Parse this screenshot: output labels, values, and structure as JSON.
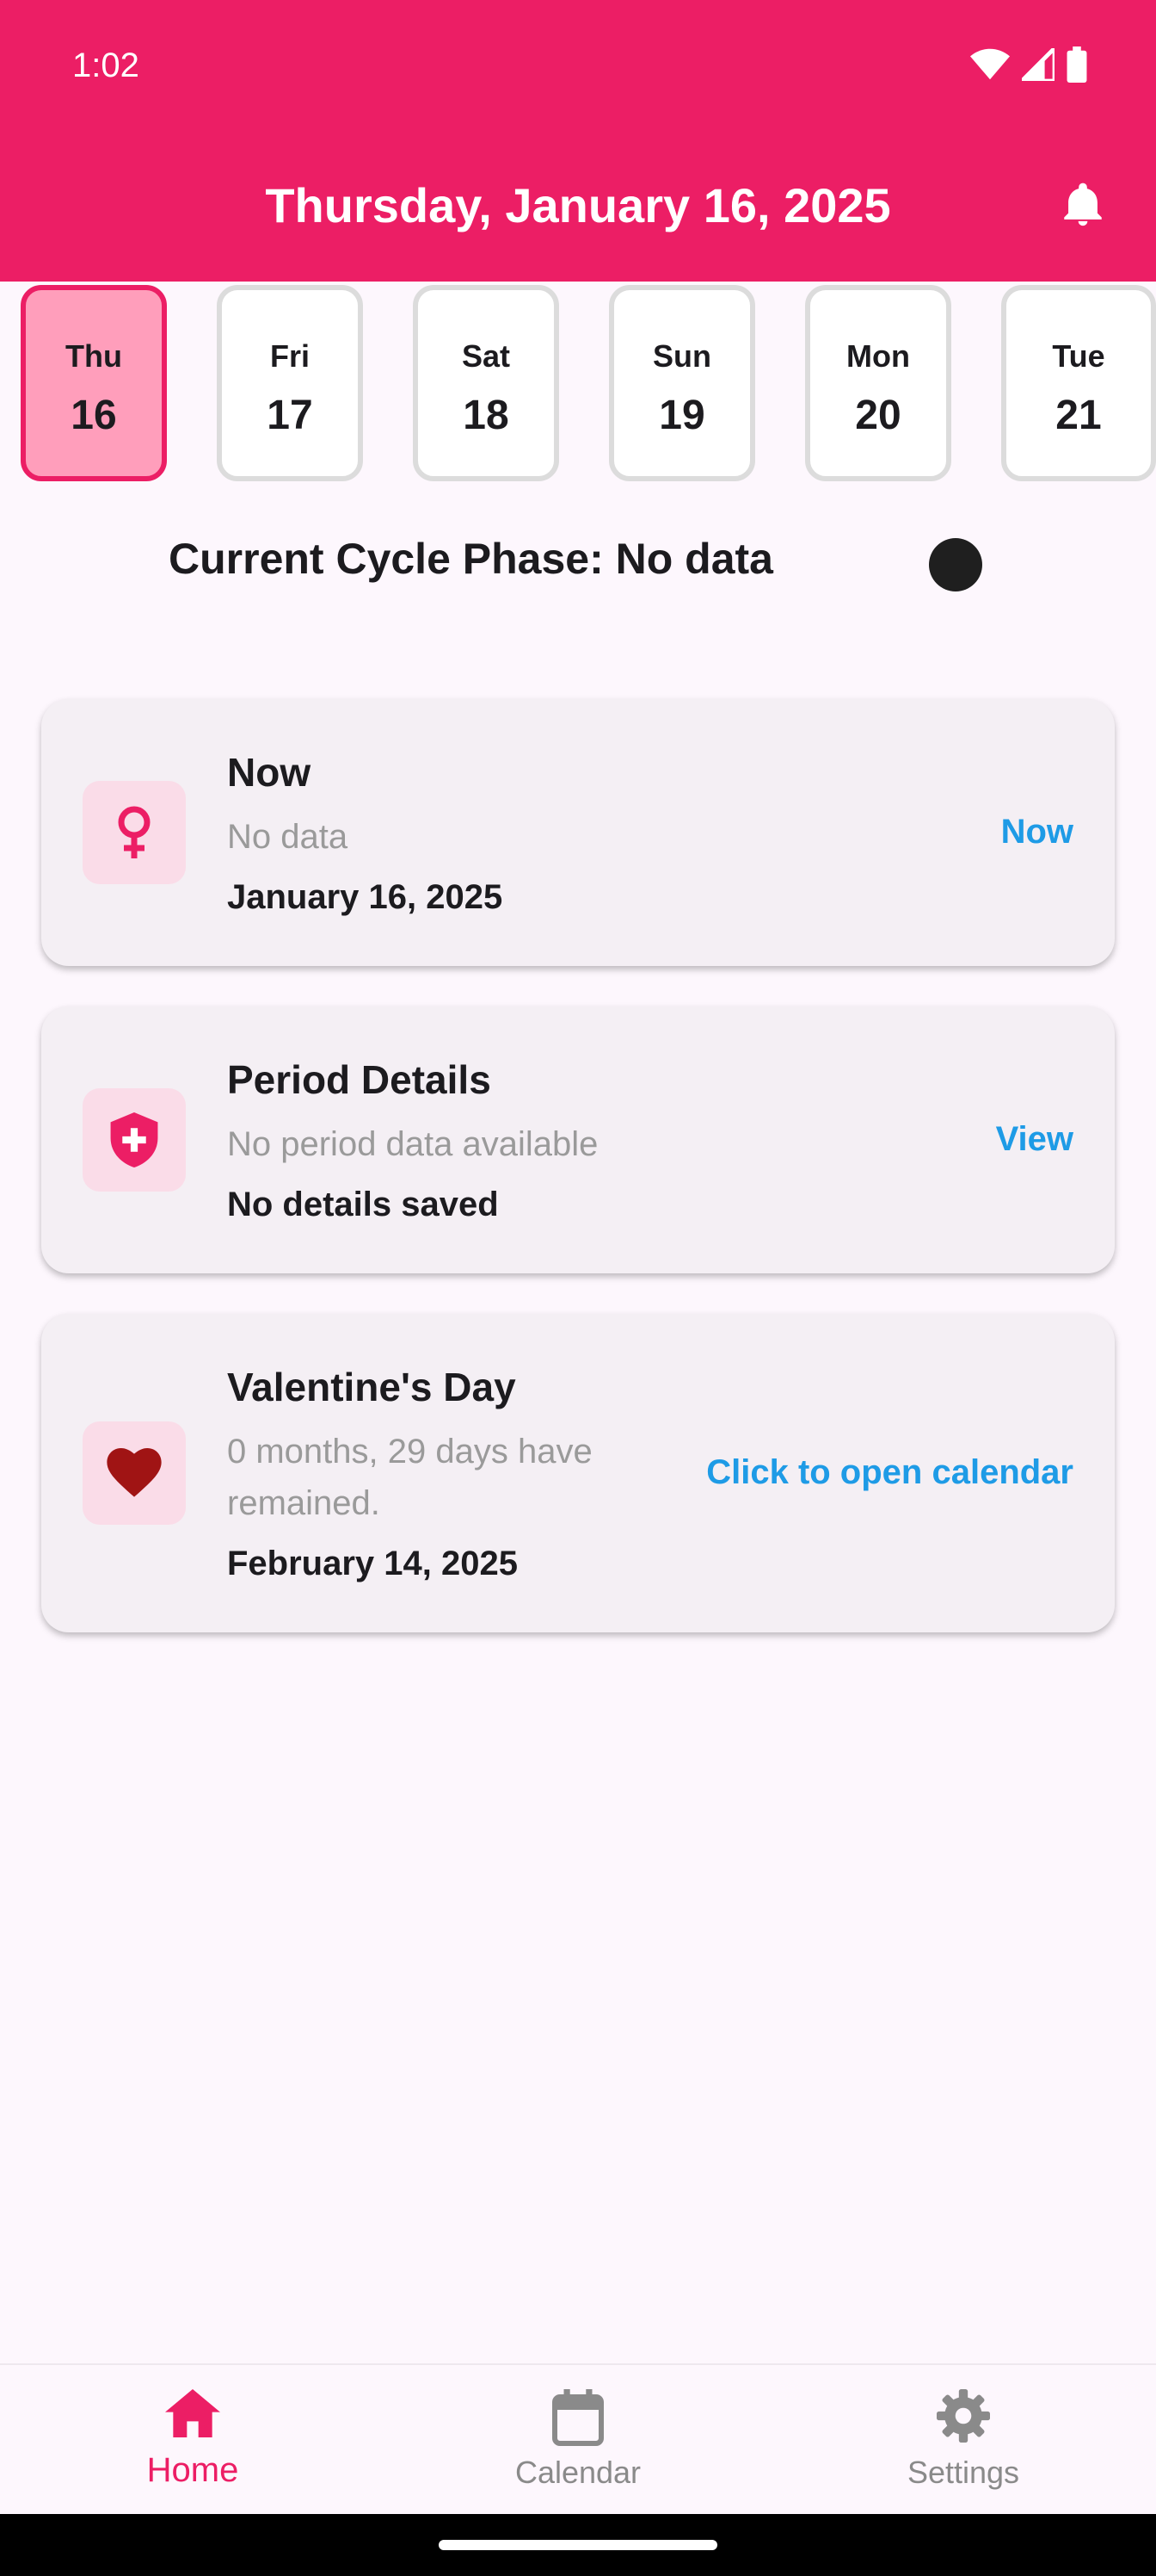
{
  "status_bar": {
    "time": "1:02"
  },
  "header": {
    "title": "Thursday, January 16, 2025"
  },
  "days": [
    {
      "name": "Thu",
      "num": "16"
    },
    {
      "name": "Fri",
      "num": "17"
    },
    {
      "name": "Sat",
      "num": "18"
    },
    {
      "name": "Sun",
      "num": "19"
    },
    {
      "name": "Mon",
      "num": "20"
    },
    {
      "name": "Tue",
      "num": "21"
    }
  ],
  "phase": {
    "text": "Current Cycle Phase: No data"
  },
  "cards": [
    {
      "title": "Now",
      "subtitle": "No data",
      "detail": "January 16, 2025",
      "action": "Now",
      "icon": "female-icon"
    },
    {
      "title": "Period Details",
      "subtitle": "No period data available",
      "detail": "No details saved",
      "action": "View",
      "icon": "shield-plus-icon"
    },
    {
      "title": "Valentine's Day",
      "subtitle": "0 months, 29 days have remained.",
      "detail": "February 14, 2025",
      "action": "Click to open calendar",
      "icon": "heart-icon"
    }
  ],
  "nav": {
    "items": [
      {
        "label": "Home",
        "icon": "home-icon",
        "active": true
      },
      {
        "label": "Calendar",
        "icon": "calendar-icon",
        "active": false
      },
      {
        "label": "Settings",
        "icon": "settings-icon",
        "active": false
      }
    ]
  },
  "colors": {
    "brand": "#EC1E65",
    "selected_day": "#FF9EBB",
    "action_link": "#1E9BE6",
    "heart": "#A01414"
  }
}
